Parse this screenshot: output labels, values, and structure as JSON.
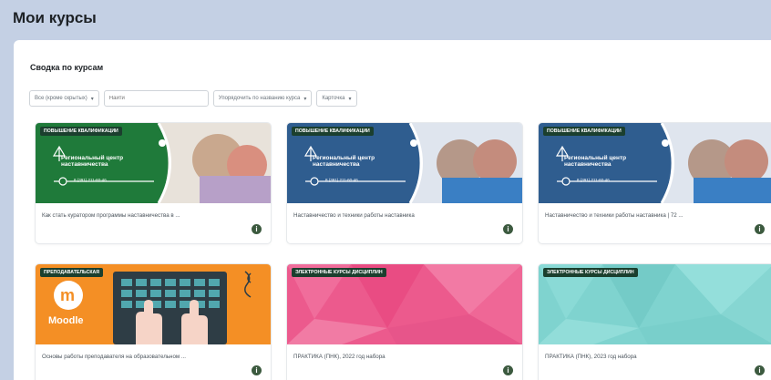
{
  "page_title": "Мои курсы",
  "section_title": "Сводка по курсам",
  "filters": {
    "grouping": "Все (кроме скрытых)",
    "search_placeholder": "Найти",
    "sort": "Упорядочить по названию курса",
    "view": "Карточка"
  },
  "banner": {
    "brand_line1": "Региональный центр",
    "brand_line2": "наставничества",
    "phone": "8 (391) 211-60-46"
  },
  "moodle": {
    "word": "Moodle",
    "letter": "m"
  },
  "courses": [
    {
      "category": "ПОВЫШЕНИЕ КВАЛИФИКАЦИИ",
      "title": "Как стать куратором программы наставничества в ..."
    },
    {
      "category": "ПОВЫШЕНИЕ КВАЛИФИКАЦИИ",
      "title": "Наставничество и техники работы наставника"
    },
    {
      "category": "ПОВЫШЕНИЕ КВАЛИФИКАЦИИ",
      "title": "Наставничество и техники работы наставника | 72 ..."
    },
    {
      "category": "ПРЕПОДАВАТЕЛЬСКАЯ",
      "title": "Основы работы преподавателя на образовательном ..."
    },
    {
      "category": "ЭЛЕКТРОННЫЕ КУРСЫ ДИСЦИПЛИН",
      "title": "ПРАКТИКА (ПНК), 2022 год набора"
    },
    {
      "category": "ЭЛЕКТРОННЫЕ КУРСЫ ДИСЦИПЛИН",
      "title": "ПРАКТИКА (ПНК), 2023 год набора"
    }
  ],
  "info_glyph": "i",
  "colors": {
    "banner_green": "#1f7a3a",
    "banner_blue": "#2f5d8f",
    "pink": "#ec5a8d",
    "teal": "#7fd3cf",
    "moodle_orange": "#f48f25",
    "badge": "#1b3f2e"
  }
}
